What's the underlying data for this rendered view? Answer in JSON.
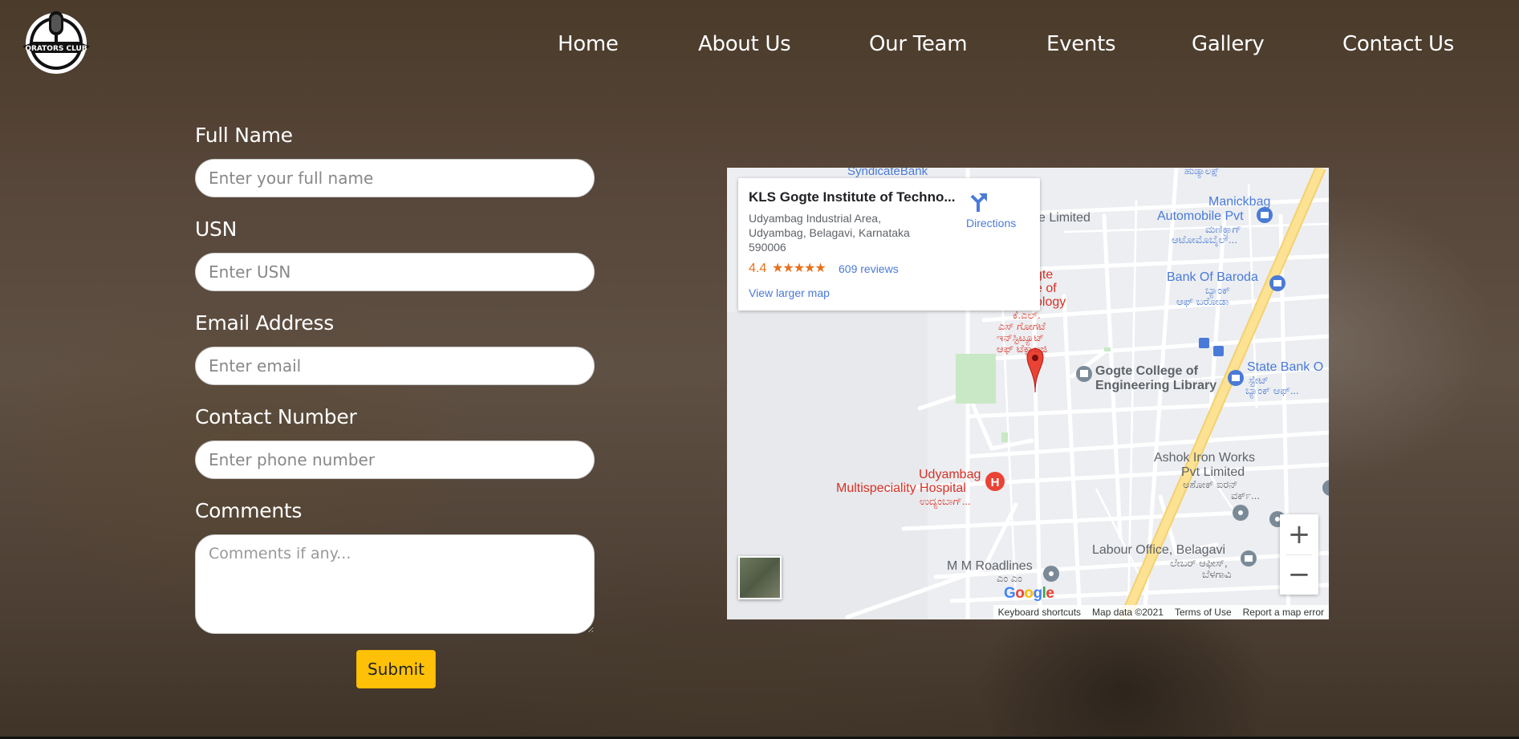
{
  "brand": {
    "logo_text": "ORATORS CLUB"
  },
  "nav": [
    {
      "label": "Home"
    },
    {
      "label": "About Us"
    },
    {
      "label": "Our Team"
    },
    {
      "label": "Events"
    },
    {
      "label": "Gallery"
    },
    {
      "label": "Contact Us"
    }
  ],
  "form": {
    "full_name": {
      "label": "Full Name",
      "placeholder": "Enter your full name",
      "value": ""
    },
    "usn": {
      "label": "USN",
      "placeholder": "Enter USN",
      "value": ""
    },
    "email": {
      "label": "Email Address",
      "placeholder": "Enter email",
      "value": ""
    },
    "contact": {
      "label": "Contact Number",
      "placeholder": "Enter phone number",
      "value": ""
    },
    "comments": {
      "label": "Comments",
      "placeholder": "Comments if any...",
      "value": ""
    },
    "submit_label": "Submit"
  },
  "map": {
    "info": {
      "name": "KLS Gogte Institute of Techno...",
      "address": "Udyambag Industrial Area, Udyambag, Belagavi, Karnataka 590006",
      "rating": "4.4",
      "stars": "★★★★★",
      "reviews": "609 reviews",
      "larger_map": "View larger map",
      "directions": "Directions"
    },
    "labels": {
      "syndicate": "SyndicateBank",
      "limited": "e Limited",
      "manickbag1": "Manickbag",
      "manickbag2": "Automobile Pvt",
      "manickbag3": "ಮಣಿಕ್ಬಾಗ್",
      "manickbag4": "ಆಟೋಮೊಬೈಲ್...",
      "top_kn": "ಹುಡ್ಯಾಲಕ್ಷ್",
      "bob1": "Bank Of Baroda",
      "bob2": "ಬ್ಯಾಂಕ್",
      "bob3": "ಆಫ್ ಬರೋಡಾ",
      "gogte_red1": "gte",
      "gogte_red2": "e of",
      "gogte_red3": "ology",
      "gogte_kn1": "ಕೆ.ಎಲ್.",
      "gogte_kn2": "ಎಸ್ ಗೋಗಟೆ",
      "gogte_kn3": "ಇನ್‌ಸ್ಟಿಟ್ಯೂಟ್",
      "gogte_kn4": "ಆಫ್ ಟೆಕ್ನಾಲಜಿ",
      "library1": "Gogte College of",
      "library2": "Engineering Library",
      "sbi1": "State Bank O",
      "sbi2": "ಸ್ಟೇಟ್",
      "sbi3": "ಬ್ಯಾಂಕ್ ಆಫ್...",
      "ashok1": "Ashok Iron Works",
      "ashok2": "Pvt Limited",
      "ashok3": "ಅಶೋಕ್ ಐರನ್",
      "ashok4": "ವರ್ಕ್...",
      "hospital1": "Udyambag",
      "hospital2": "Multispeciality Hospital",
      "hospital3": "ಉದ್ಯಂಬಾಗ್...",
      "labour1": "Labour Office, Belagavi",
      "labour2": "ಲೇಬರ್ ಆಫೀಸ್,",
      "labour3": "ಬೆಳಗಾವಿ",
      "mm1": "M M Roadlines",
      "mm2": "ಎಂ ಎಂ"
    },
    "google": "Google",
    "attribution": {
      "shortcuts": "Keyboard shortcuts",
      "data": "Map data ©2021",
      "terms": "Terms of Use",
      "report": "Report a map error"
    },
    "colors": {
      "pin": "#ea4335",
      "road_major": "#fde293",
      "poi_blue": "#4a7ad8",
      "poi_gray": "#7b8a97",
      "red_text": "#d93025"
    }
  }
}
